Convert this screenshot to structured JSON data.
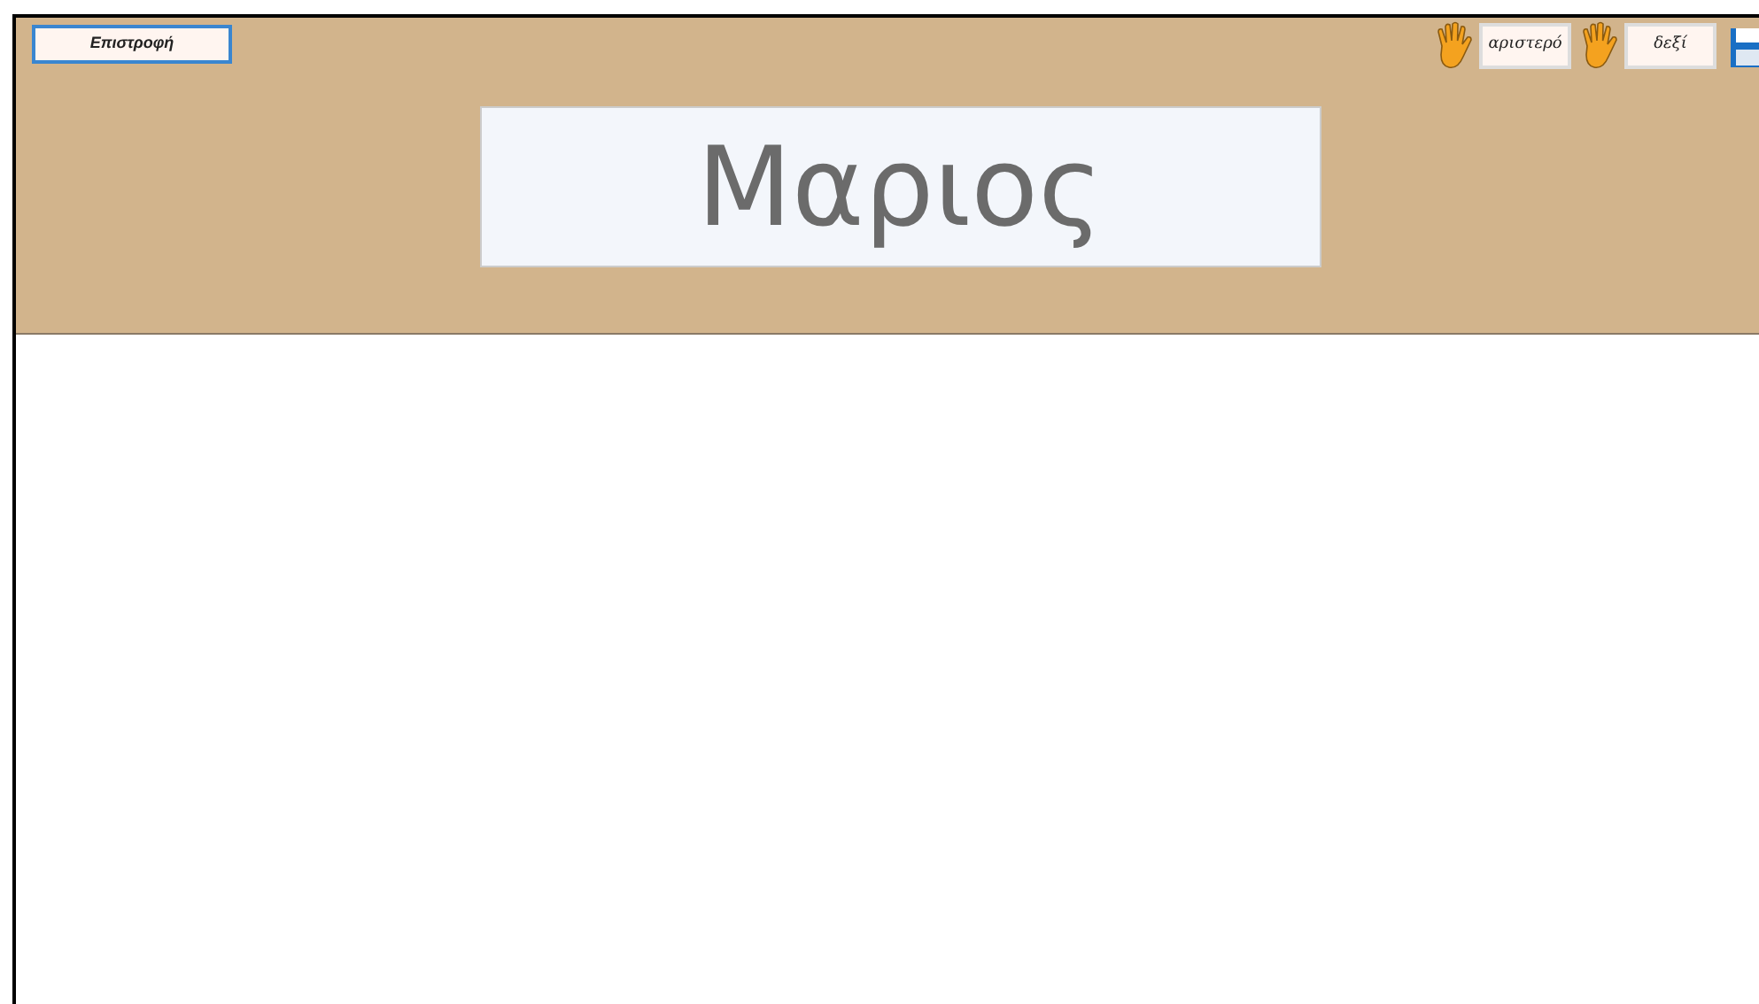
{
  "back_button": {
    "label": "Επιστροφή"
  },
  "hand_buttons": [
    {
      "label": "αριστερό"
    },
    {
      "label": "δεξί"
    }
  ],
  "title": "Μαριος"
}
